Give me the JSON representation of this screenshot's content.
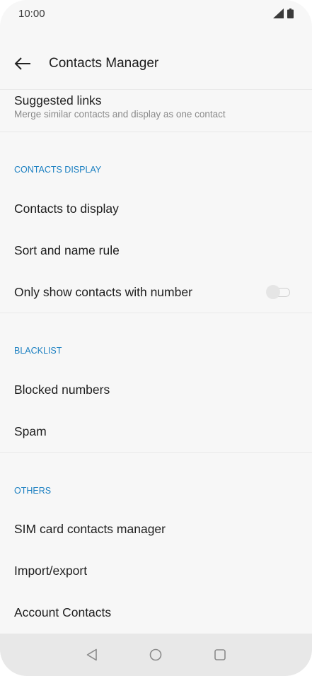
{
  "status_bar": {
    "time": "10:00"
  },
  "app_bar": {
    "title": "Contacts Manager"
  },
  "items": {
    "suggested_links": {
      "title": "Suggested links",
      "subtitle": "Merge similar contacts and display as one contact"
    },
    "contacts_to_display": "Contacts to display",
    "sort_and_name_rule": "Sort and name rule",
    "only_show_with_number": "Only show contacts with number",
    "blocked_numbers": "Blocked numbers",
    "spam": "Spam",
    "sim_card_manager": "SIM card contacts manager",
    "import_export": "Import/export",
    "account_contacts": "Account Contacts"
  },
  "sections": {
    "contacts_display": "CONTACTS DISPLAY",
    "blacklist": "BLACKLIST",
    "others": "OTHERS"
  },
  "toggles": {
    "only_show_with_number": false
  },
  "colors": {
    "accent": "#1a7fc1",
    "background": "#f7f7f7",
    "nav_bar": "#e8e8e8"
  }
}
